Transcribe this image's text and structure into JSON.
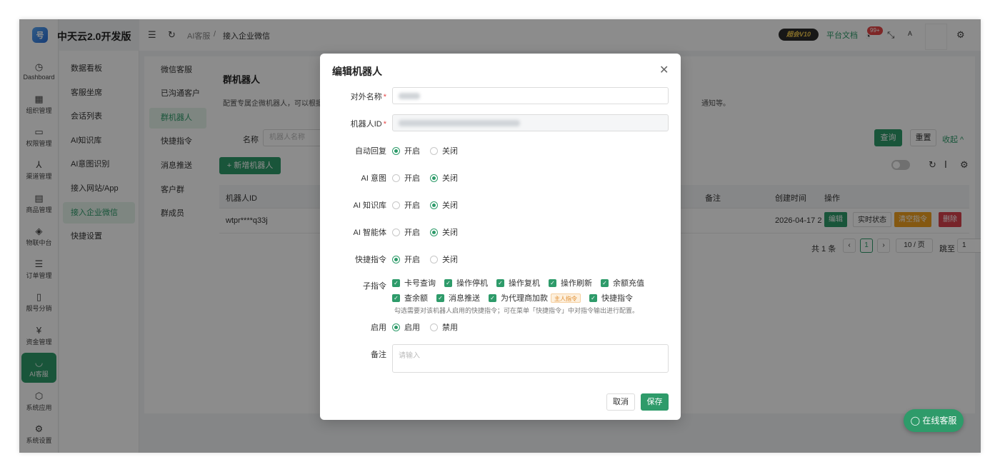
{
  "app": {
    "title": "中天云2.0开发版",
    "logo_glyph": "号"
  },
  "rail": [
    {
      "label": "Dashboard",
      "icon": "◷",
      "icon_name": "dashboard-icon"
    },
    {
      "label": "组织管理",
      "icon": "▦",
      "icon_name": "org-icon"
    },
    {
      "label": "权限管理",
      "icon": "▭",
      "icon_name": "monitor-icon"
    },
    {
      "label": "渠道管理",
      "icon": "⅄",
      "icon_name": "channel-icon"
    },
    {
      "label": "商品管理",
      "icon": "▤",
      "icon_name": "shop-icon"
    },
    {
      "label": "物联中台",
      "icon": "◈",
      "icon_name": "iot-icon"
    },
    {
      "label": "订单管理",
      "icon": "☰",
      "icon_name": "order-icon"
    },
    {
      "label": "靓号分销",
      "icon": "▯",
      "icon_name": "phone-icon"
    },
    {
      "label": "资金管理",
      "icon": "¥",
      "icon_name": "money-icon"
    },
    {
      "label": "AI客服",
      "icon": "◡",
      "icon_name": "ai-service-icon"
    },
    {
      "label": "系统应用",
      "icon": "⬡",
      "icon_name": "apps-icon"
    },
    {
      "label": "系统设置",
      "icon": "⚙",
      "icon_name": "settings-icon"
    }
  ],
  "menu2": [
    "数据看板",
    "客服坐席",
    "会话列表",
    "AI知识库",
    "AI意图识别",
    "接入网站/App",
    "接入企业微信",
    "快捷设置"
  ],
  "header": {
    "breadcrumb": [
      "AI客服",
      "/",
      "接入企业微信"
    ],
    "vip": "超会V10",
    "doc_link": "平台文档",
    "notif_count": "99+"
  },
  "tabs3": [
    "微信客服",
    "已沟通客户",
    "群机器人",
    "快捷指令",
    "消息推送",
    "客户群",
    "群成员"
  ],
  "page": {
    "title": "群机器人",
    "desc": "配置专属企微机器人，可以根据",
    "desc_tail": "通知等。",
    "filter_label": "名称",
    "filter_placeholder": "机器人名称",
    "search": "查询",
    "reset": "重置",
    "collapse": "收起 ^",
    "add": "+ 新增机器人"
  },
  "table": {
    "headers": {
      "id": "机器人ID",
      "remark": "备注",
      "created": "创建时间",
      "actions": "操作"
    },
    "rows": [
      {
        "id": "wtpr****q33j",
        "created": "2026-04-17 2"
      }
    ],
    "actions": {
      "edit": "编辑",
      "status": "实时状态",
      "clear": "清空指令",
      "delete": "删除"
    }
  },
  "pager": {
    "total": "共 1 条",
    "page": "1",
    "size": "10 / 页",
    "jump_label": "跳至",
    "jump_value": "1"
  },
  "colors": {
    "primary": "#2e9b6a",
    "warn": "#f0a020",
    "danger": "#d9434e"
  },
  "modal": {
    "title": "编辑机器人",
    "fields": {
      "name_label": "对外名称",
      "id_label": "机器人ID",
      "auto_reply_label": "自动回复",
      "ai_intent_label": "AI 意图",
      "ai_kb_label": "AI 知识库",
      "ai_agent_label": "AI 智能体",
      "quick_cmd_label": "快捷指令",
      "sub_cmd_label": "子指令",
      "enable_label": "启用",
      "remark_label": "备注"
    },
    "opt_on": "开启",
    "opt_off": "关闭",
    "enable_on": "启用",
    "enable_off": "禁用",
    "sub_cmds_row1": [
      "卡号查询",
      "操作停机",
      "操作复机",
      "操作刷新",
      "余额充值"
    ],
    "sub_cmds_row2": [
      "查余额",
      "消息推送",
      "为代理商加款",
      "快捷指令"
    ],
    "owner_tag": "主人指令",
    "hint": "勾选需要对该机器人启用的快捷指令；可在菜单「快捷指令」中对指令输出进行配置。",
    "remark_placeholder": "请输入",
    "cancel": "取消",
    "save": "保存"
  },
  "chat_button": "在线客服"
}
